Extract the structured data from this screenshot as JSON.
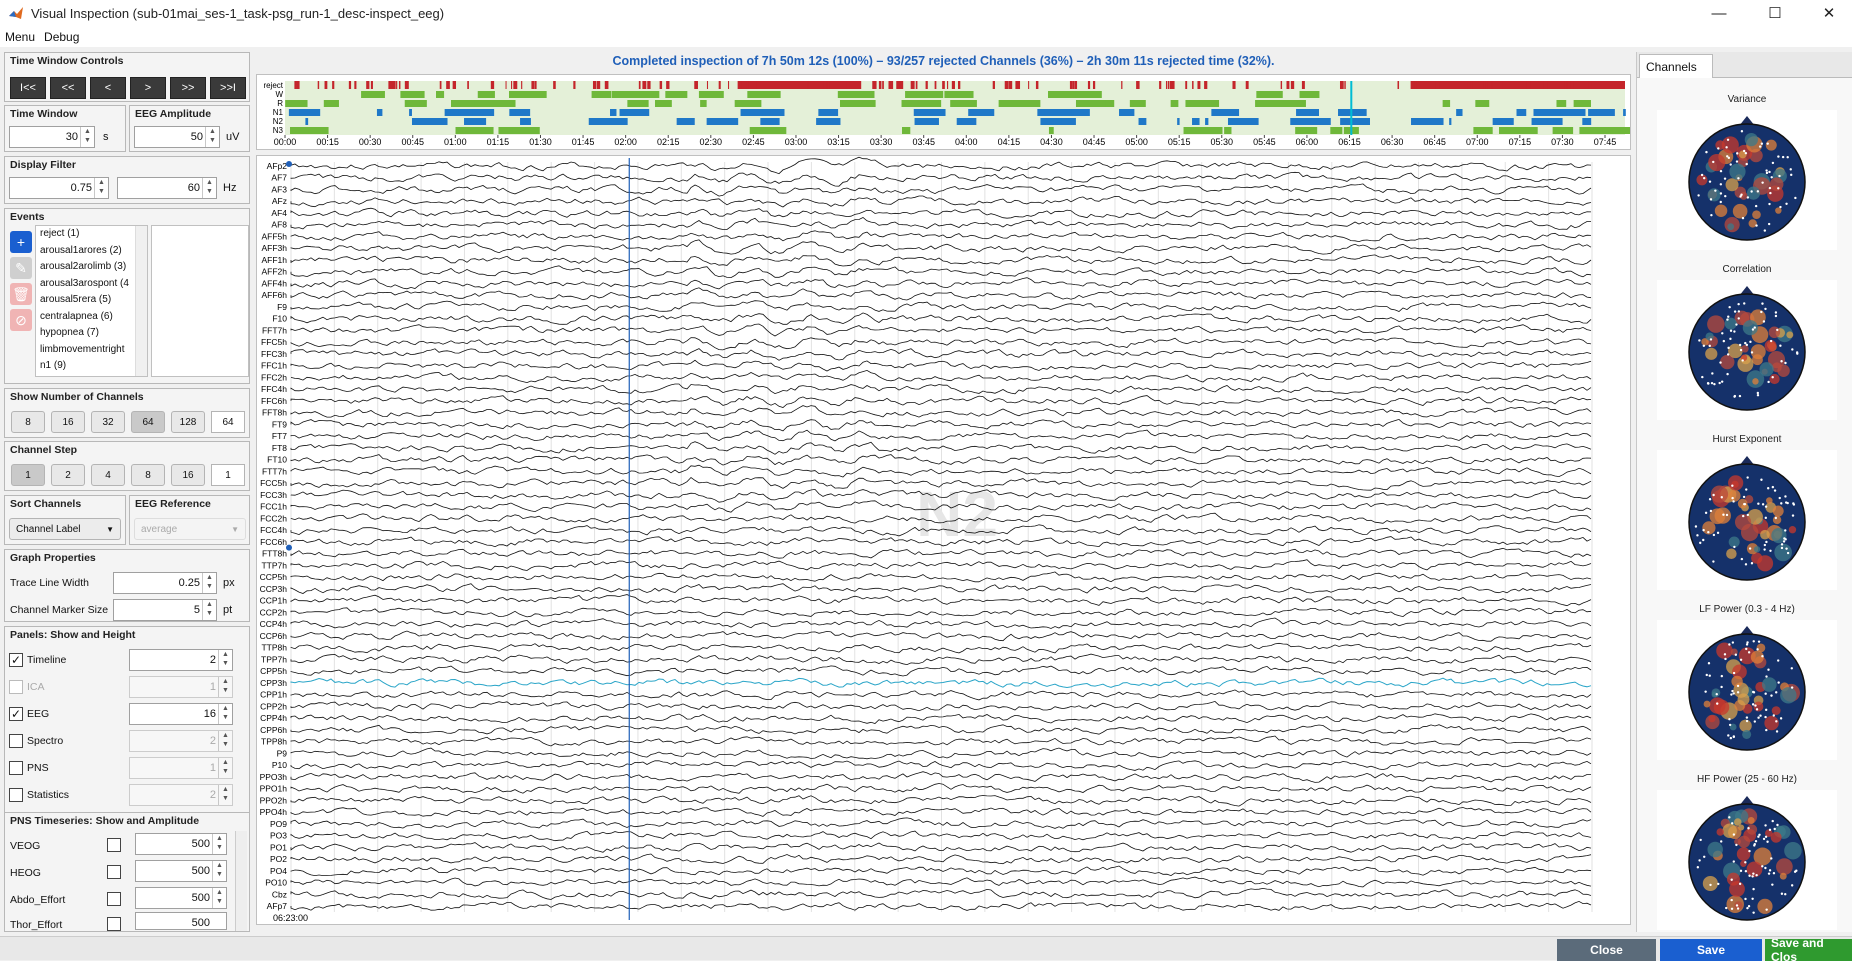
{
  "window": {
    "title": "Visual Inspection (sub-01mai_ses-1_task-psg_run-1_desc-inspect_eeg)",
    "controls": {
      "minimize": "—",
      "maximize": "☐",
      "close": "✕"
    }
  },
  "menubar": {
    "items": [
      "Menu",
      "Debug"
    ]
  },
  "time_window_controls": {
    "header": "Time Window Controls",
    "buttons": [
      "I<<",
      "<<",
      "<",
      ">",
      ">>",
      ">>I"
    ]
  },
  "time_window": {
    "header": "Time Window",
    "value": "30",
    "unit": "s"
  },
  "eeg_amplitude": {
    "header": "EEG Amplitude",
    "value": "50",
    "unit": "uV"
  },
  "display_filter": {
    "header": "Display Filter",
    "low": "0.75",
    "high": "60",
    "unit": "Hz"
  },
  "events": {
    "header": "Events",
    "items": [
      "reject (1)",
      "arousal1arores (2)",
      "arousal2arolimb (3)",
      "arousal3arospont (4",
      "arousal5rera (5)",
      "centralapnea (6)",
      "hypopnea (7)",
      "limbmovementright",
      "n1 (9)"
    ]
  },
  "show_channels": {
    "header": "Show Number of Channels",
    "options": [
      "8",
      "16",
      "32",
      "64",
      "128"
    ],
    "selected": "64",
    "custom": "64"
  },
  "channel_step": {
    "header": "Channel Step",
    "options": [
      "1",
      "2",
      "4",
      "8",
      "16"
    ],
    "selected": "1",
    "custom": "1"
  },
  "sort_channels": {
    "header": "Sort Channels",
    "value": "Channel Label"
  },
  "eeg_reference": {
    "header": "EEG Reference",
    "value": "average"
  },
  "graph_properties": {
    "header": "Graph Properties",
    "trace_line_width": {
      "label": "Trace Line Width",
      "value": "0.25",
      "unit": "px"
    },
    "channel_marker_size": {
      "label": "Channel Marker Size",
      "value": "5",
      "unit": "pt"
    }
  },
  "panels": {
    "header": "Panels: Show and Height",
    "rows": [
      {
        "label": "Timeline",
        "checked": true,
        "enabled": true,
        "value": "2"
      },
      {
        "label": "ICA",
        "checked": false,
        "enabled": false,
        "value": "1"
      },
      {
        "label": "EEG",
        "checked": true,
        "enabled": true,
        "value": "16"
      },
      {
        "label": "Spectro",
        "checked": false,
        "enabled": true,
        "value": "2"
      },
      {
        "label": "PNS",
        "checked": false,
        "enabled": true,
        "value": "1"
      },
      {
        "label": "Statistics",
        "checked": false,
        "enabled": true,
        "value": "2"
      }
    ]
  },
  "pns_timeseries": {
    "header": "PNS Timeseries: Show and Amplitude",
    "rows": [
      {
        "label": "VEOG",
        "value": "500"
      },
      {
        "label": "HEOG",
        "value": "500"
      },
      {
        "label": "Abdo_Effort",
        "value": "500"
      },
      {
        "label": "Thor_Effort",
        "value": "500"
      }
    ]
  },
  "status": {
    "text": "Completed inspection of 7h 50m 12s (100%) – 93/257 rejected Channels (36%) – 2h 30m 11s rejected time (32%)."
  },
  "timeline": {
    "row_labels": [
      "reject",
      "W",
      "R",
      "N1",
      "N2",
      "N3"
    ],
    "ticks": [
      "00:00",
      "00:15",
      "00:30",
      "00:45",
      "01:00",
      "01:15",
      "01:30",
      "01:45",
      "02:00",
      "02:15",
      "02:30",
      "02:45",
      "03:00",
      "03:15",
      "03:30",
      "03:45",
      "04:00",
      "04:15",
      "04:30",
      "04:45",
      "05:00",
      "05:15",
      "05:30",
      "05:45",
      "06:00",
      "06:15",
      "06:30",
      "06:45",
      "07:00",
      "07:15",
      "07:30",
      "07:45"
    ],
    "colors": {
      "reject": "#c4252b",
      "wake": "#6fb83a",
      "n1": "#1f78c8",
      "cursor": "#00bcd4",
      "bg": "#e4f0d8"
    }
  },
  "eeg": {
    "time_label": "06:23:00",
    "watermark": "N2",
    "channels": [
      "AFp2",
      "AF7",
      "AF3",
      "AFz",
      "AF4",
      "AF8",
      "AFF5h",
      "AFF3h",
      "AFF1h",
      "AFF2h",
      "AFF4h",
      "AFF6h",
      "F9",
      "F10",
      "FFT7h",
      "FFC5h",
      "FFC3h",
      "FFC1h",
      "FFC2h",
      "FFC4h",
      "FFC6h",
      "FFT8h",
      "FT9",
      "FT7",
      "FT8",
      "FT10",
      "FTT7h",
      "FCC5h",
      "FCC3h",
      "FCC1h",
      "FCC2h",
      "FCC4h",
      "FCC6h",
      "FTT8h",
      "TTP7h",
      "CCP5h",
      "CCP3h",
      "CCP1h",
      "CCP2h",
      "CCP4h",
      "CCP6h",
      "TTP8h",
      "TPP7h",
      "CPP5h",
      "CPP3h",
      "CPP1h",
      "CPP2h",
      "CPP4h",
      "CPP6h",
      "TPP8h",
      "P9",
      "P10",
      "PPO3h",
      "PPO1h",
      "PPO2h",
      "PPO4h",
      "PO9",
      "PO3",
      "PO1",
      "PO2",
      "PO4",
      "PO10",
      "Cbz",
      "AFp7"
    ],
    "highlight_channel": "CPP3h",
    "colors": {
      "trace": "#111111",
      "highlight": "#2aa5c8",
      "marker": "#1f5fb8"
    }
  },
  "right_panel": {
    "tab": "Channels",
    "topoplots": [
      "Variance",
      "Correlation",
      "Hurst Exponent",
      "LF Power (0.3 - 4 Hz)",
      "HF Power (25 - 60 Hz)"
    ]
  },
  "bottom_buttons": {
    "close": "Close",
    "save": "Save",
    "save_close": "Save and Clos"
  },
  "colors": {
    "dark_btn": "#3a3a3a",
    "primary": "#1a5fd0",
    "success": "#2f9a2f",
    "close_btn": "#5b6b7a"
  }
}
